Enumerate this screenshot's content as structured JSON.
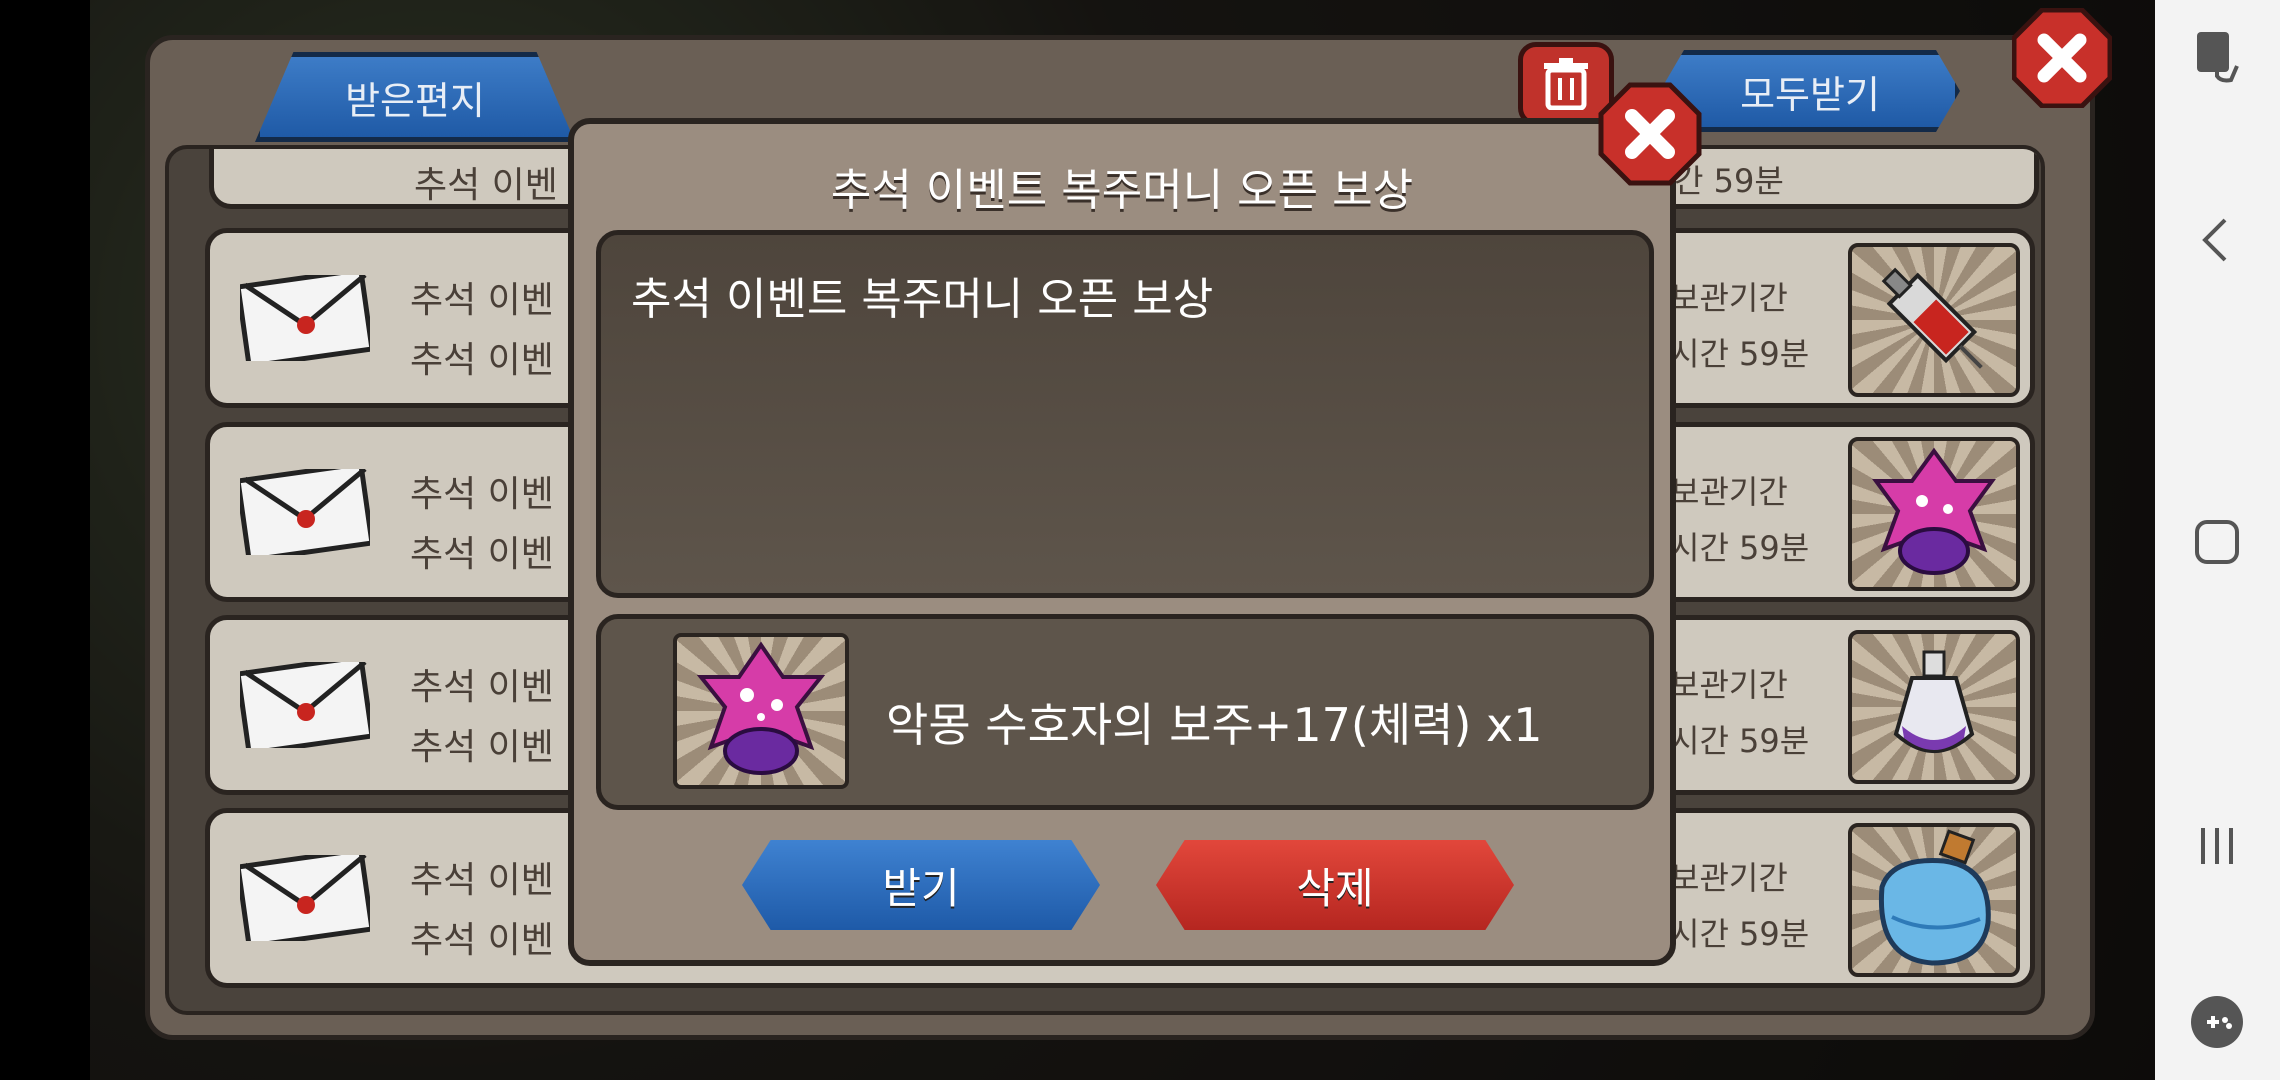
{
  "mailbox": {
    "tab_label": "받은편지",
    "receive_all_label": "모두받기",
    "rows": [
      {
        "line1": "추석 이벤",
        "line2": "추석 이벤",
        "exp1": "보관기간",
        "exp2": "시간 59분",
        "item_icon": "syringe-icon"
      },
      {
        "line1": "추석 이벤",
        "line2": "추석 이벤",
        "exp1": "보관기간",
        "exp2": "시간 59분",
        "item_icon": "nightmare-orb-icon"
      },
      {
        "line1": "추석 이벤",
        "line2": "추석 이벤",
        "exp1": "보관기간",
        "exp2": "시간 59분",
        "item_icon": "potion-bottle-icon"
      },
      {
        "line1": "추석 이벤",
        "line2": "추석 이벤",
        "exp1": "보관기간",
        "exp2": "시간 59분",
        "item_icon": "water-flask-icon"
      }
    ],
    "top_row": {
      "line": "추석 이벤",
      "exp": "간 59분"
    }
  },
  "modal": {
    "title": "추석 이벤트 복주머니 오픈 보상",
    "body": "추석 이벤트 복주머니 오픈 보상",
    "reward_text": "악몽 수호자의 보주+17(체력) x1",
    "reward_icon": "nightmare-orb-icon",
    "accept_label": "받기",
    "delete_label": "삭제"
  },
  "colors": {
    "blue_button": "#2f6fbe",
    "red_button": "#c9302a",
    "panel": "#9b8d80"
  }
}
